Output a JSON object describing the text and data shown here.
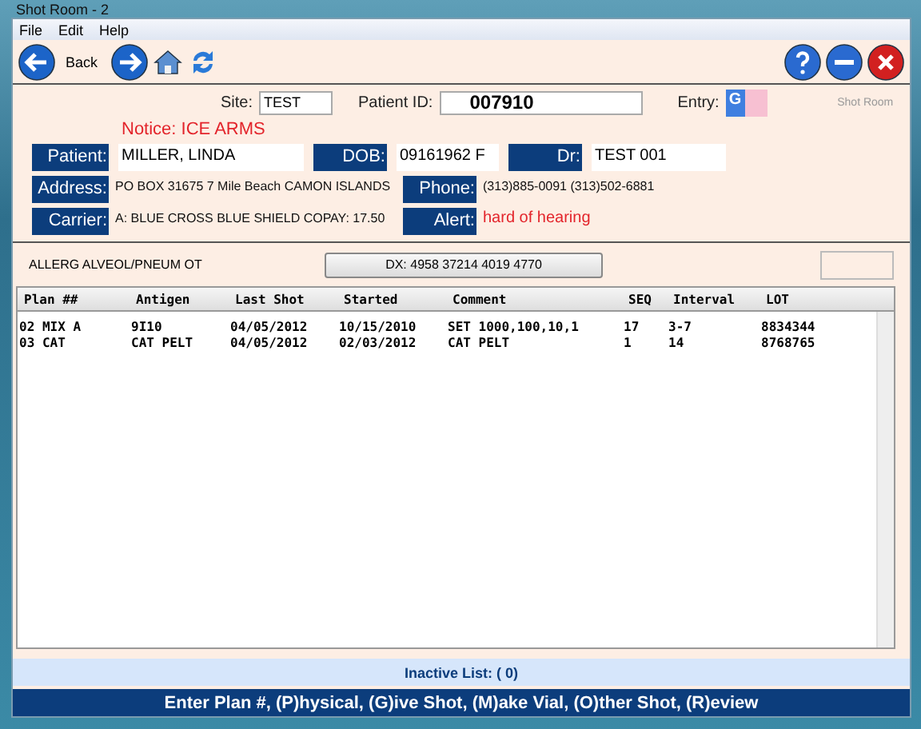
{
  "window": {
    "title": "Shot Room - 2"
  },
  "menu": [
    "File",
    "Edit",
    "Help"
  ],
  "toolbar": {
    "back_label": "Back"
  },
  "header": {
    "site_label": "Site:",
    "site": "TEST",
    "patient_id_label": "Patient ID:",
    "patient_id": "007910",
    "entry_label": "Entry:",
    "entry": "G",
    "caption": "Shot Room"
  },
  "notice": "Notice: ICE ARMS",
  "fields": [
    {
      "label": "Patient:",
      "value": "MILLER, LINDA",
      "kind": "box"
    },
    {
      "label": "DOB:",
      "value": "09161962  F",
      "kind": "box"
    },
    {
      "label": "Dr:",
      "value": "TEST 001",
      "kind": "box"
    },
    {
      "label": "Address:",
      "value": "PO BOX 31675 7 Mile Beach CAMON ISLANDS",
      "kind": "plain"
    },
    {
      "label": "Phone:",
      "value": "(313)885-0091 (313)502-6881",
      "kind": "plain"
    },
    {
      "label": "Carrier:",
      "value": "A: BLUE CROSS BLUE SHIELD COPAY:   17.50",
      "kind": "plain"
    },
    {
      "label": "Alert:",
      "value": "hard of hearing",
      "kind": "alert"
    }
  ],
  "allergy": "ALLERG ALVEOL/PNEUM OT",
  "dx_button": "DX: 4958  37214 4019  4770",
  "table": {
    "columns": [
      "Plan ##",
      "Antigen",
      "Last Shot",
      "Started",
      "Comment",
      "SEQ",
      "Interval",
      "LOT"
    ],
    "rows": [
      [
        "02 MIX A",
        "9I10",
        "04/05/2012",
        "10/15/2010",
        "SET 1000,100,10,1",
        "17",
        "3-7",
        "8834344"
      ],
      [
        "03 CAT",
        "CAT PELT",
        "04/05/2012",
        "02/03/2012",
        "CAT PELT",
        "1",
        "14",
        "8768765"
      ]
    ]
  },
  "inactive": "Inactive List:  ( 0)",
  "command": "Enter Plan #, (P)hysical, (G)ive Shot, (M)ake Vial, (O)ther Shot, (R)eview"
}
